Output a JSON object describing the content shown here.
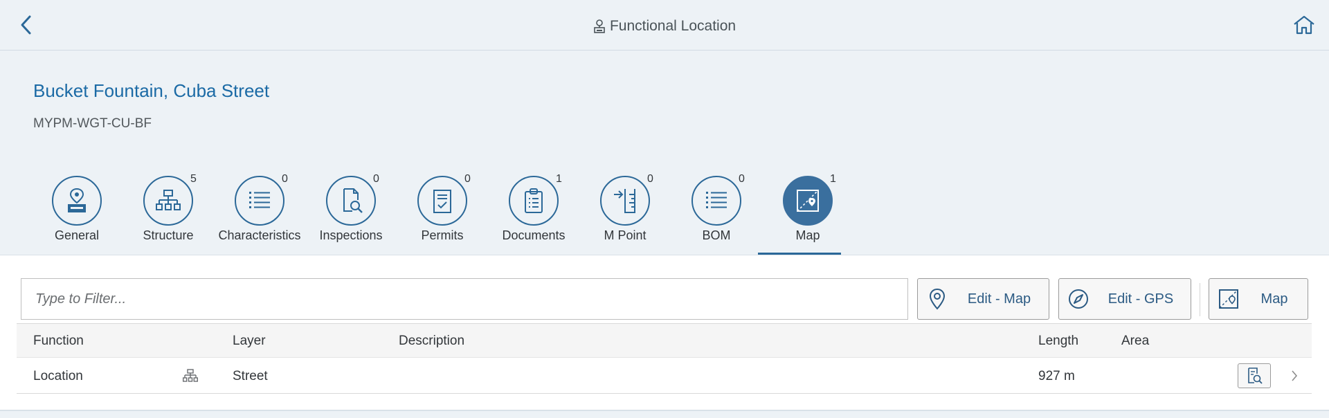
{
  "shell": {
    "title": "Functional Location",
    "back_icon": "chevron-left-icon",
    "home_icon": "home-icon",
    "title_icon": "functional-location-icon"
  },
  "header": {
    "title": "Bucket Fountain, Cuba Street",
    "subtitle": "MYPM-WGT-CU-BF"
  },
  "tabs": [
    {
      "label": "General",
      "count": "",
      "icon": "location-pin-icon",
      "active": false
    },
    {
      "label": "Structure",
      "count": "5",
      "icon": "hierarchy-icon",
      "active": false
    },
    {
      "label": "Characteristics",
      "count": "0",
      "icon": "list-icon",
      "active": false
    },
    {
      "label": "Inspections",
      "count": "0",
      "icon": "document-search-icon",
      "active": false
    },
    {
      "label": "Permits",
      "count": "0",
      "icon": "clipboard-check-icon",
      "active": false
    },
    {
      "label": "Documents",
      "count": "1",
      "icon": "clipboard-list-icon",
      "active": false
    },
    {
      "label": "M Point",
      "count": "0",
      "icon": "measurement-point-icon",
      "active": false
    },
    {
      "label": "BOM",
      "count": "0",
      "icon": "list-icon",
      "active": false
    },
    {
      "label": "Map",
      "count": "1",
      "icon": "map-icon",
      "active": true
    }
  ],
  "filter": {
    "placeholder": "Type to Filter..."
  },
  "buttons": {
    "edit_map": "Edit - Map",
    "edit_gps": "Edit - GPS",
    "map": "Map"
  },
  "table": {
    "columns": [
      "Function",
      "Layer",
      "Description",
      "Length",
      "Area"
    ],
    "rows": [
      {
        "function": "Location",
        "layer": "Street",
        "description": "",
        "length": "927 m",
        "area": ""
      }
    ]
  },
  "colors": {
    "accent": "#2b6898",
    "title_blue": "#1b6aa5",
    "background": "#edf2f6"
  }
}
